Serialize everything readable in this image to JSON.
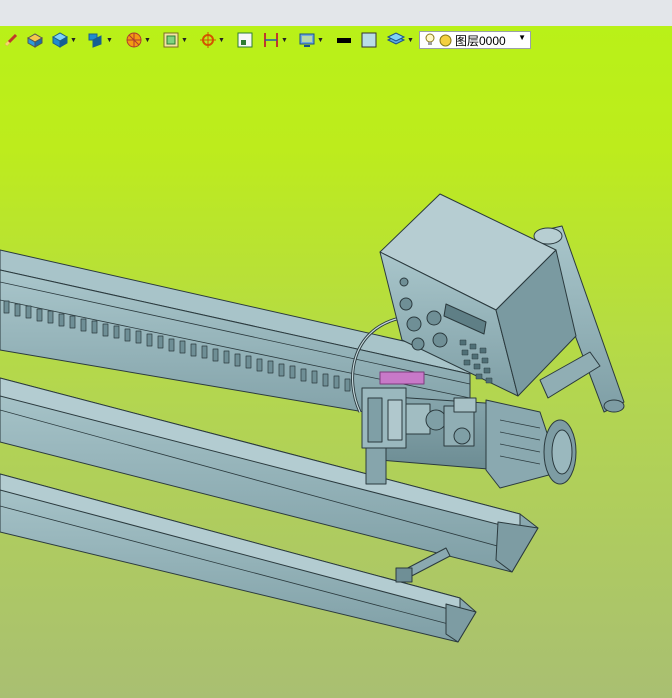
{
  "toolbar": {
    "items": [
      {
        "icon": "pencil-icon"
      },
      {
        "icon": "extrude-icon"
      },
      {
        "icon": "cube-view-icon"
      },
      {
        "icon": "view-orientation-icon"
      },
      {
        "icon": "render-mode-icon"
      },
      {
        "icon": "zoom-window-icon"
      },
      {
        "icon": "target-icon"
      },
      {
        "icon": "snap-icon"
      },
      {
        "icon": "dimension-icon"
      },
      {
        "icon": "display-settings-icon"
      },
      {
        "icon": "line-color-icon"
      },
      {
        "icon": "fill-color-icon"
      },
      {
        "icon": "layer-stack-icon"
      }
    ],
    "layer_selector": {
      "value": "图层0000",
      "icons": [
        "light-bulb-icon",
        "layer-status-circle-icon"
      ]
    }
  },
  "colors": {
    "viewport_top": "#b9f118",
    "viewport_bottom": "#a9bf72",
    "model_fill": "#8fb0b6",
    "model_edge": "#2b3a3e"
  }
}
